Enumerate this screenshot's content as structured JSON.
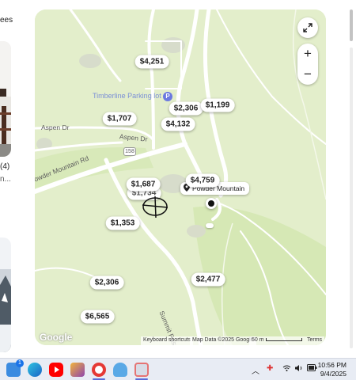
{
  "listing_column": {
    "top_text": "ees",
    "rating_text": "(4)",
    "name_text": "n..."
  },
  "map": {
    "prices": [
      {
        "label": "$4,251"
      },
      {
        "label": "$2,306"
      },
      {
        "label": "$1,199"
      },
      {
        "label": "$1,707"
      },
      {
        "label": "$4,132"
      },
      {
        "label": "$4,759"
      },
      {
        "label": "$1,687"
      },
      {
        "label": "$1,734"
      },
      {
        "label": "$1,353"
      },
      {
        "label": "$2,306"
      },
      {
        "label": "$2,477"
      },
      {
        "label": "$6,565"
      }
    ],
    "road_labels": {
      "aspen_dr_1": "Aspen Dr",
      "aspen_dr_2": "Aspen Dr",
      "powder_mountain_rd": "Powder Mountain Rd",
      "route_shield": "158",
      "summit_pass_rd": "Summit Pass Rd"
    },
    "poi": {
      "name": "Timberline Parking lot",
      "badge": "P"
    },
    "place_card": {
      "name": "Powder Mountain"
    },
    "controls": {
      "fullscreen_icon": "fullscreen-icon",
      "zoom_in": "+",
      "zoom_out": "−"
    },
    "attribution": {
      "logo": "Google",
      "shortcuts": "Keyboard shortcuts",
      "map_data": "Map Data ©2025 Google",
      "scale": "50 m",
      "terms": "Terms"
    }
  },
  "taskbar": {
    "notification_badge": "1",
    "clock_time": "10:56 PM",
    "clock_date": "9/4/2025",
    "colors": {
      "bar": "#e8ecf4",
      "accent": "#1a73e8"
    }
  }
}
